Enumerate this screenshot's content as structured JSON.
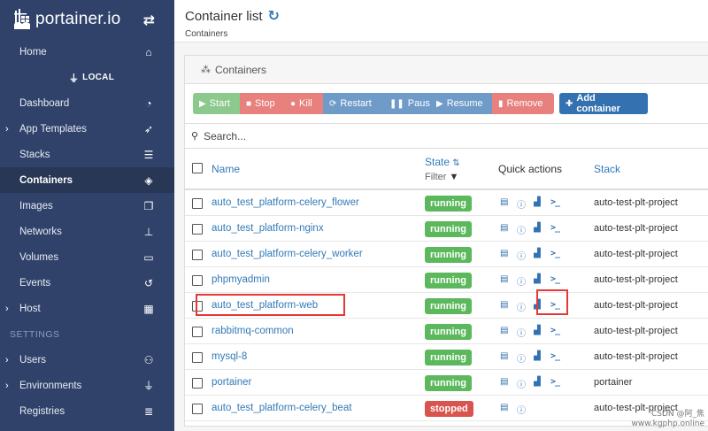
{
  "brand": {
    "name": "portainer.io"
  },
  "sidebar": {
    "endpoint": "LOCAL",
    "items": [
      {
        "label": "Home",
        "icon": "home-icon",
        "glyph": "⌂"
      },
      {
        "label": "Dashboard",
        "icon": "dashboard-icon",
        "glyph": "◔"
      },
      {
        "label": "App Templates",
        "icon": "rocket-icon",
        "glyph": "➶",
        "expandable": true
      },
      {
        "label": "Stacks",
        "icon": "list-icon",
        "glyph": "☰"
      },
      {
        "label": "Containers",
        "icon": "cubes-icon",
        "glyph": "◈",
        "active": true
      },
      {
        "label": "Images",
        "icon": "clone-icon",
        "glyph": "❐"
      },
      {
        "label": "Networks",
        "icon": "sitemap-icon",
        "glyph": "⊥"
      },
      {
        "label": "Volumes",
        "icon": "hdd-icon",
        "glyph": "▭"
      },
      {
        "label": "Events",
        "icon": "history-icon",
        "glyph": "↺"
      },
      {
        "label": "Host",
        "icon": "th-icon",
        "glyph": "▦",
        "expandable": true
      }
    ],
    "settings_heading": "SETTINGS",
    "settings_items": [
      {
        "label": "Users",
        "icon": "users-icon",
        "glyph": "⚇",
        "expandable": true
      },
      {
        "label": "Environments",
        "icon": "plug-icon",
        "glyph": "⏚",
        "expandable": true
      },
      {
        "label": "Registries",
        "icon": "database-icon",
        "glyph": "≣"
      }
    ]
  },
  "header": {
    "title": "Container list",
    "subtitle": "Containers"
  },
  "widget": {
    "title": "Containers"
  },
  "toolbar": {
    "start": "Start",
    "stop": "Stop",
    "kill": "Kill",
    "restart": "Restart",
    "pause": "Pause",
    "resume": "Resume",
    "remove": "Remove",
    "add": "Add container"
  },
  "search": {
    "placeholder": "Search..."
  },
  "table": {
    "col_name": "Name",
    "col_state": "State",
    "state_filter": "Filter",
    "col_quick_actions": "Quick actions",
    "col_stack": "Stack",
    "rows": [
      {
        "name": "auto_test_platform-celery_flower",
        "state": "running",
        "stack": "auto-test-plt-project"
      },
      {
        "name": "auto_test_platform-nginx",
        "state": "running",
        "stack": "auto-test-plt-project"
      },
      {
        "name": "auto_test_platform-celery_worker",
        "state": "running",
        "stack": "auto-test-plt-project"
      },
      {
        "name": "phpmyadmin",
        "state": "running",
        "stack": "auto-test-plt-project"
      },
      {
        "name": "auto_test_platform-web",
        "state": "running",
        "stack": "auto-test-plt-project"
      },
      {
        "name": "rabbitmq-common",
        "state": "running",
        "stack": "auto-test-plt-project"
      },
      {
        "name": "mysql-8",
        "state": "running",
        "stack": "auto-test-plt-project"
      },
      {
        "name": "portainer",
        "state": "running",
        "stack": "portainer"
      },
      {
        "name": "auto_test_platform-celery_beat",
        "state": "stopped",
        "stack": "auto-test-plt-project"
      }
    ]
  },
  "watermark": {
    "line1": "CSDN @阿_焦",
    "line2": "www.kgphp.online"
  },
  "colors": {
    "sidebar": "#30426a",
    "running": "#5cb85c",
    "stopped": "#d9534f",
    "link": "#337ab7",
    "annotation": "#e53935"
  }
}
